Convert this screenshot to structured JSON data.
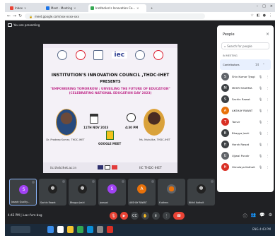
{
  "browser": {
    "tabs": [
      {
        "label": "Inbox",
        "color": "#ea4335",
        "active": false
      },
      {
        "label": "Meet - Meeting",
        "color": "#1a73e8",
        "active": false
      },
      {
        "label": "Institution's Innovation Co...",
        "color": "#34a853",
        "active": true
      }
    ],
    "url": "meet.google.com/xxx-xxxx-xxx"
  },
  "meeting": {
    "speaker_label": "You are presenting",
    "slide": {
      "logo_text": "iec",
      "title": "INSTITUTION'S INNOVATION COUNCIL ,THDC-IHET",
      "presents": "PRESENTS",
      "theme": "\"EMPOWERING TOMORROW : UNVEILING THE FUTURE OF EDUCATION\" (CELEBRATING NATIONAL EDUCATION DAY 2023)",
      "date": "11TH NOV 2023",
      "time": "4:30 PM",
      "mode": "GOOGLE MEET",
      "speaker_left": "Dr. Pradeep Kumar, THDC-IHET",
      "speaker_right": "Ms. Mukulika, THDC-IHET",
      "footer_url": "iic.thdcihet.ac.in",
      "footer_right": "IIC THDC-IHET"
    },
    "participants": [
      {
        "name": "Joseph Quality...",
        "initial": "S",
        "color": "#a142f4",
        "image": false
      },
      {
        "name": "Sachin Rawat",
        "initial": "",
        "color": "#000000",
        "image": true
      },
      {
        "name": "Bhagya Joshi",
        "initial": "",
        "color": "#000000",
        "image": true
      },
      {
        "name": "jaanpal",
        "initial": "S",
        "color": "#a142f4",
        "image": false
      },
      {
        "name": "AKSHAY RAWAT",
        "initial": "A",
        "color": "#e8710a",
        "image": false
      },
      {
        "name": "6 others",
        "initial": "",
        "color": "#5f6368",
        "image": true
      },
      {
        "name": "Nikhil Kathait",
        "initial": "",
        "color": "#000000",
        "image": true
      }
    ],
    "info": "4:43 PM | iuac-fvm-bxg",
    "controls": [
      "mic",
      "cam",
      "captions",
      "raise-hand",
      "present",
      "more",
      "end"
    ]
  },
  "people": {
    "title": "People",
    "search_placeholder": "Search for people",
    "section": "IN MEETING",
    "rows": [
      {
        "name": "Contributors",
        "initial": "",
        "color": "#1a73e8",
        "count": "14"
      },
      {
        "name": "Shiv Kumar Tyagi",
        "initial": "S",
        "color": "#5f6368"
      },
      {
        "name": "MIHIR SHARMA",
        "initial": "M",
        "color": "#3c4043"
      },
      {
        "name": "Sachin Rawat",
        "initial": "S",
        "color": "#3c4043"
      },
      {
        "name": "AKSHAY RAWAT",
        "initial": "A",
        "color": "#e8710a"
      },
      {
        "name": "Tanvir",
        "initial": "T",
        "color": "#d93025"
      },
      {
        "name": "Bhagya Joshi",
        "initial": "B",
        "color": "#3c4043"
      },
      {
        "name": "Harsh Rawat",
        "initial": "H",
        "color": "#3c4043"
      },
      {
        "name": "Ujjwal Pundir",
        "initial": "U",
        "color": "#5f6368"
      },
      {
        "name": "Himalaya Kathait",
        "initial": "H",
        "color": "#d93025"
      }
    ]
  },
  "taskbar": {
    "tray": "ENG  4:43 PM"
  }
}
